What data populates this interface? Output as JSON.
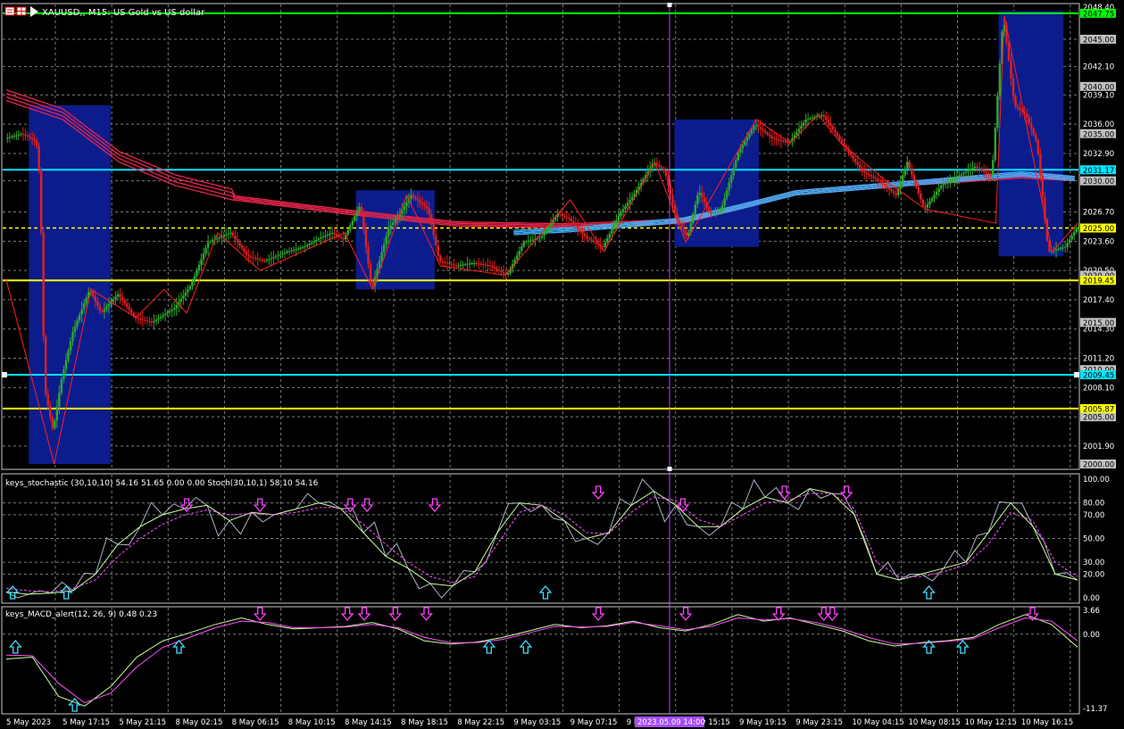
{
  "window": {
    "title": "XAUUSD,, M15:  US Gold vs US dollar"
  },
  "panes": {
    "main": {
      "price_labels": [
        "2048.40",
        "2045.00",
        "2042.10",
        "2039.10",
        "2036.00",
        "2032.90",
        "2030.00",
        "2026.70",
        "2023.60",
        "2020.50",
        "2017.40",
        "2014.30",
        "2011.20",
        "2008.10",
        "2005.00",
        "2001.90",
        "2000.00"
      ],
      "hlines": [
        {
          "name": "green-level-line",
          "price": 2047.75,
          "label": "2047.75",
          "color": "#00ff00",
          "label_bg": "#00ff00",
          "label_fg": "#000000",
          "style": "solid"
        },
        {
          "name": "cyan-level-line-upper",
          "price": 2031.17,
          "label": "2031.17",
          "color": "#00e5ff",
          "label_bg": "#00e5ff",
          "label_fg": "#000000",
          "style": "solid"
        },
        {
          "name": "yellow-level-line-upper",
          "price": 2025.0,
          "label": "2025.00",
          "color": "#ffff00",
          "label_bg": "#ffff00",
          "label_fg": "#000000",
          "style": "dashed"
        },
        {
          "name": "yellow-level-line-middle",
          "price": 2019.45,
          "label": "2019.45",
          "color": "#ffff00",
          "label_bg": "#ffff00",
          "label_fg": "#000000",
          "style": "solid"
        },
        {
          "name": "cyan-level-line-lower",
          "price": 2009.45,
          "label": "2009.45",
          "color": "#00e5ff",
          "label_bg": "#00e5ff",
          "label_fg": "#000000",
          "style": "solid"
        },
        {
          "name": "yellow-level-line-lower",
          "price": 2005.87,
          "label": "2005.87",
          "color": "#ffff00",
          "label_bg": "#ffff00",
          "label_fg": "#000000",
          "style": "solid"
        }
      ],
      "grey_labels": [
        "2045.00",
        "2040.00",
        "2035.00",
        "2030.00",
        "2020.00",
        "2015.00",
        "2010.00",
        "2005.00",
        "2000.00"
      ]
    },
    "stochastic": {
      "title": "keys_stochastic (30,10,10) 54.16 51.65 0.00 0.00 Stoch(30,10,1) 58.10 54.16",
      "labels": [
        "100.00",
        "80.00",
        "70.00",
        "50.00",
        "30.00",
        "20.00",
        "0.00"
      ]
    },
    "macd": {
      "title": "keys_MACD_alert(12, 26, 9) 0.48 0.23",
      "labels": [
        "3.66",
        "0.00",
        "-11.37"
      ]
    }
  },
  "time_axis": {
    "labels": [
      "5 May 2023",
      "5 May 17:15",
      "5 May 21:15",
      "8 May 02:15",
      "8 May 06:15",
      "8 May 10:15",
      "8 May 14:15",
      "8 May 18:15",
      "8 May 22:15",
      "9 May 03:15",
      "9 May 07:15",
      "9 May 11:15",
      "9 May 15:15",
      "9 May 19:15",
      "9 May 23:15",
      "10 May 04:15",
      "10 May 08:15",
      "10 May 12:15",
      "10 May 16:15"
    ],
    "crosshair_label": "2023.05.09 14:00"
  },
  "chart_data": {
    "type": "candlestick",
    "symbol": "XAUUSD",
    "timeframe": "M15",
    "description": "US Gold vs US dollar",
    "ylim": [
      2000.0,
      2048.4
    ],
    "x_categories": [
      "5 May 2023",
      "5 May 17:15",
      "5 May 21:15",
      "8 May 02:15",
      "8 May 06:15",
      "8 May 10:15",
      "8 May 14:15",
      "8 May 18:15",
      "8 May 22:15",
      "9 May 03:15",
      "9 May 07:15",
      "9 May 11:15",
      "9 May 15:15",
      "9 May 19:15",
      "9 May 23:15",
      "10 May 04:15",
      "10 May 08:15",
      "10 May 12:15",
      "10 May 16:15"
    ],
    "price_path": [
      [
        0,
        2034.5
      ],
      [
        0.3,
        2035.0
      ],
      [
        0.55,
        2034.2
      ],
      [
        0.62,
        2030.0
      ],
      [
        0.7,
        2008.0
      ],
      [
        0.85,
        2003.5
      ],
      [
        1.0,
        2009.0
      ],
      [
        1.2,
        2014.0
      ],
      [
        1.5,
        2018.5
      ],
      [
        1.7,
        2016.0
      ],
      [
        2.0,
        2018.0
      ],
      [
        2.3,
        2015.5
      ],
      [
        2.6,
        2015.0
      ],
      [
        3.0,
        2016.5
      ],
      [
        3.3,
        2019.0
      ],
      [
        3.6,
        2023.5
      ],
      [
        4.0,
        2024.5
      ],
      [
        4.3,
        2022.0
      ],
      [
        4.6,
        2021.5
      ],
      [
        5.0,
        2022.5
      ],
      [
        5.3,
        2023.0
      ],
      [
        5.6,
        2024.0
      ],
      [
        5.8,
        2024.5
      ],
      [
        6.0,
        2023.8
      ],
      [
        6.3,
        2027.5
      ],
      [
        6.5,
        2018.5
      ],
      [
        6.8,
        2025.0
      ],
      [
        7.0,
        2026.5
      ],
      [
        7.2,
        2028.5
      ],
      [
        7.5,
        2027.0
      ],
      [
        7.7,
        2021.5
      ],
      [
        8.0,
        2021.0
      ],
      [
        8.3,
        2021.3
      ],
      [
        8.6,
        2021.0
      ],
      [
        8.9,
        2020.0
      ],
      [
        9.2,
        2023.5
      ],
      [
        9.5,
        2024.0
      ],
      [
        9.8,
        2026.5
      ],
      [
        10.0,
        2026.0
      ],
      [
        10.3,
        2024.0
      ],
      [
        10.6,
        2023.0
      ],
      [
        10.9,
        2026.5
      ],
      [
        11.2,
        2029.0
      ],
      [
        11.5,
        2032.0
      ],
      [
        11.7,
        2031.0
      ],
      [
        11.9,
        2026.0
      ],
      [
        12.1,
        2024.0
      ],
      [
        12.3,
        2029.0
      ],
      [
        12.5,
        2026.5
      ],
      [
        12.7,
        2027.0
      ],
      [
        13.0,
        2033.0
      ],
      [
        13.3,
        2036.0
      ],
      [
        13.6,
        2034.5
      ],
      [
        13.9,
        2034.0
      ],
      [
        14.2,
        2036.5
      ],
      [
        14.5,
        2037.0
      ],
      [
        14.9,
        2033.5
      ],
      [
        15.2,
        2031.0
      ],
      [
        15.5,
        2030.0
      ],
      [
        15.8,
        2028.5
      ],
      [
        16.0,
        2032.0
      ],
      [
        16.3,
        2027.0
      ],
      [
        16.6,
        2029.5
      ],
      [
        16.9,
        2030.5
      ],
      [
        17.2,
        2031.5
      ],
      [
        17.5,
        2030.5
      ],
      [
        17.7,
        2047.5
      ],
      [
        17.9,
        2038.0
      ],
      [
        18.1,
        2037.0
      ],
      [
        18.3,
        2034.0
      ],
      [
        18.5,
        2022.5
      ],
      [
        18.8,
        2023.0
      ],
      [
        19.0,
        2025.0
      ]
    ],
    "moving_averages": [
      {
        "name": "ma-red",
        "color": "#e8254b",
        "values": [
          [
            0,
            2038.5
          ],
          [
            1,
            2036.5
          ],
          [
            2,
            2032.0
          ],
          [
            3,
            2029.5
          ],
          [
            4,
            2028.0
          ],
          [
            6,
            2026.5
          ],
          [
            8,
            2025.2
          ],
          [
            10,
            2025.0
          ],
          [
            12,
            2025.5
          ],
          [
            13,
            2027.0
          ],
          [
            14,
            2028.5
          ],
          [
            16,
            2029.5
          ],
          [
            18,
            2030.3
          ],
          [
            19,
            2030.0
          ]
        ]
      },
      {
        "name": "ma-blue",
        "color": "#3fb4ff",
        "values": [
          [
            9,
            2024.3
          ],
          [
            10,
            2024.6
          ],
          [
            12,
            2025.6
          ],
          [
            13,
            2027.0
          ],
          [
            14,
            2028.5
          ],
          [
            16,
            2029.5
          ],
          [
            18,
            2030.5
          ],
          [
            19,
            2030.0
          ]
        ]
      }
    ],
    "zigzag_color": "#ff2020",
    "highlight_boxes": [
      {
        "x0": 0.4,
        "x1": 1.85,
        "price_high": 2038.0,
        "price_low": 2000.0
      },
      {
        "x0": 6.2,
        "x1": 7.6,
        "price_high": 2029.0,
        "price_low": 2018.5
      },
      {
        "x0": 11.85,
        "x1": 13.35,
        "price_high": 2036.5,
        "price_low": 2023.0
      },
      {
        "x0": 17.6,
        "x1": 18.75,
        "price_high": 2048.0,
        "price_low": 2022.0
      }
    ],
    "stochastic": {
      "ylim": [
        0,
        100
      ],
      "main_values": [
        5,
        3,
        4,
        6,
        20,
        45,
        60,
        70,
        75,
        78,
        65,
        72,
        70,
        75,
        80,
        75,
        55,
        35,
        25,
        12,
        10,
        22,
        55,
        80,
        78,
        65,
        50,
        55,
        78,
        90,
        78,
        60,
        60,
        75,
        85,
        80,
        92,
        88,
        70,
        20,
        15,
        20,
        25,
        30,
        55,
        80,
        60,
        20,
        15
      ],
      "signal_values": [
        8,
        6,
        5,
        8,
        15,
        35,
        50,
        62,
        70,
        74,
        70,
        71,
        70,
        72,
        76,
        76,
        62,
        45,
        30,
        18,
        13,
        18,
        45,
        72,
        78,
        70,
        55,
        54,
        72,
        85,
        82,
        66,
        60,
        70,
        80,
        82,
        88,
        88,
        75,
        30,
        18,
        18,
        22,
        28,
        45,
        72,
        65,
        30,
        18
      ],
      "up_arrows_at": [
        0.05,
        1.0,
        9.5,
        16.3
      ],
      "down_arrows_at": [
        4.5,
        3.2,
        6.1,
        6.4,
        7.6,
        10.5,
        12.0,
        13.8,
        14.9
      ]
    },
    "macd": {
      "ylim": [
        -11.37,
        3.66
      ],
      "main_values": [
        -3.8,
        -3.5,
        -9.5,
        -11.0,
        -8.0,
        -3.5,
        -1.0,
        0.2,
        1.5,
        2.5,
        1.5,
        0.8,
        1.0,
        1.2,
        1.8,
        0.8,
        -1.0,
        -1.5,
        -1.2,
        -0.5,
        0.5,
        1.5,
        1.0,
        1.3,
        2.0,
        1.0,
        0.5,
        1.5,
        3.0,
        2.0,
        2.5,
        1.5,
        0.5,
        -1.0,
        -1.8,
        -1.3,
        -1.0,
        -0.5,
        1.5,
        3.0,
        1.5,
        -2.0
      ],
      "signal_values": [
        -3.2,
        -3.3,
        -7.5,
        -10.5,
        -9.0,
        -5.0,
        -2.0,
        -0.5,
        1.0,
        2.0,
        1.8,
        1.0,
        1.0,
        1.1,
        1.5,
        1.0,
        -0.5,
        -1.3,
        -1.3,
        -0.8,
        0.2,
        1.2,
        1.1,
        1.2,
        1.8,
        1.3,
        0.7,
        1.2,
        2.5,
        2.2,
        2.4,
        1.8,
        0.8,
        -0.5,
        -1.5,
        -1.4,
        -1.1,
        -0.7,
        1.0,
        2.5,
        2.0,
        -1.0
      ],
      "up_arrows_at": [
        0.1,
        1.15,
        3.0,
        8.5,
        9.15,
        16.3,
        16.9
      ],
      "down_arrows_at": [
        4.5,
        6.05,
        6.35,
        6.9,
        7.45,
        10.5,
        12.05,
        13.7,
        14.5,
        14.65,
        18.2
      ]
    }
  }
}
